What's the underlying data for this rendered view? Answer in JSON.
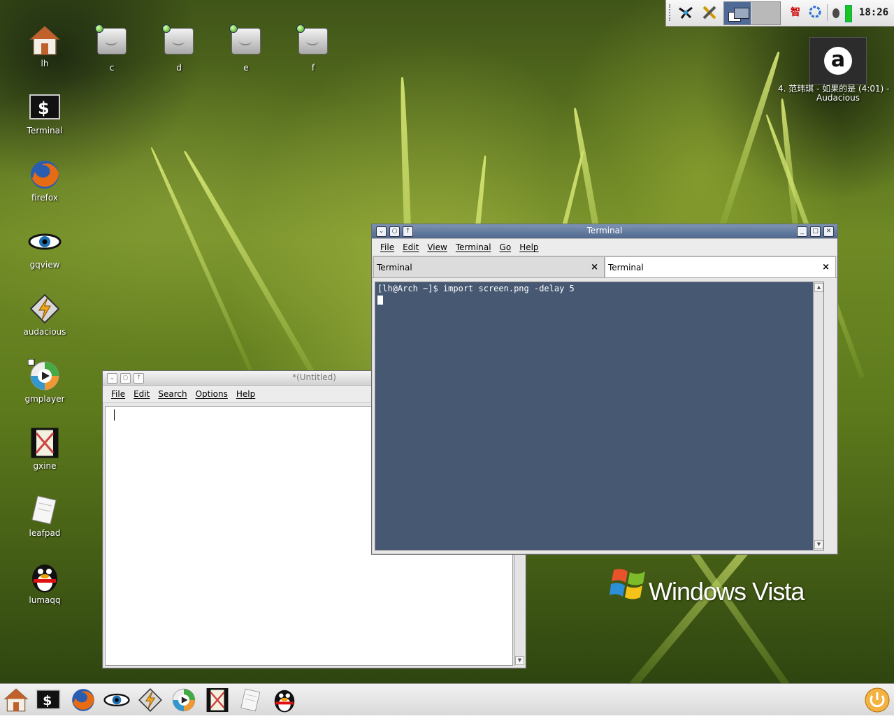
{
  "desktop": {
    "icons": [
      {
        "label": "lh",
        "icon": "home-folder-icon"
      },
      {
        "label": "c",
        "icon": "hard-drive-icon"
      },
      {
        "label": "d",
        "icon": "hard-drive-icon"
      },
      {
        "label": "e",
        "icon": "hard-drive-icon"
      },
      {
        "label": "f",
        "icon": "hard-drive-icon"
      },
      {
        "label": "Terminal",
        "icon": "terminal-icon"
      },
      {
        "label": "firefox",
        "icon": "firefox-icon"
      },
      {
        "label": "gqview",
        "icon": "eye-icon"
      },
      {
        "label": "audacious",
        "icon": "audacious-icon"
      },
      {
        "label": "gmplayer",
        "icon": "media-player-icon"
      },
      {
        "label": "gxine",
        "icon": "film-icon"
      },
      {
        "label": "leafpad",
        "icon": "notepad-icon"
      },
      {
        "label": "lumaqq",
        "icon": "penguin-icon"
      }
    ],
    "brand_text": "Windows Vista"
  },
  "audacious_widget": {
    "logo_letter": "a",
    "track": "4. 范玮琪 - 如果的是 (4:01) -",
    "app": "Audacious"
  },
  "tray": {
    "clock": "18:26",
    "input_method": "智",
    "icons": [
      "network-icon",
      "tools-icon",
      "workspace-switcher-icon",
      "input-method-icon",
      "update-icon",
      "volume-icon",
      "battery-icon"
    ]
  },
  "terminal": {
    "title": "Terminal",
    "menu": [
      "File",
      "Edit",
      "View",
      "Terminal",
      "Go",
      "Help"
    ],
    "tabs": [
      {
        "label": "Terminal",
        "close": "×"
      },
      {
        "label": "Terminal",
        "close": "×"
      }
    ],
    "prompt_line": "[lh@Arch ~]$ import screen.png -delay 5"
  },
  "leafpad": {
    "title": "*(Untitled)",
    "menu": [
      "File",
      "Edit",
      "Search",
      "Options",
      "Help"
    ]
  },
  "taskbar": {
    "launchers": [
      "home-icon",
      "terminal-icon",
      "firefox-icon",
      "gqview-icon",
      "audacious-icon",
      "gmplayer-icon",
      "gxine-icon",
      "leafpad-icon",
      "lumaqq-icon"
    ],
    "power": "power-icon"
  },
  "colors": {
    "terminal_bg": "#475873",
    "active_title": "#50688f"
  }
}
